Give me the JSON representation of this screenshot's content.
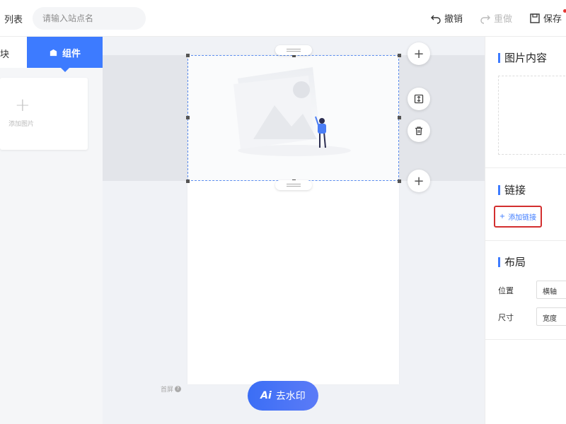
{
  "topbar": {
    "list_label": "列表",
    "search_placeholder": "请输入站点名",
    "undo_label": "撤销",
    "redo_label": "重做",
    "save_label": "保存"
  },
  "left_panel": {
    "tabs": [
      {
        "label": "块"
      },
      {
        "label": "组件"
      }
    ],
    "add_image_label": "添加图片"
  },
  "canvas": {
    "first_screen_label": "首屏",
    "watermark_button": {
      "ai_label": "Ai",
      "label": "去水印"
    }
  },
  "right_panel": {
    "image_section_title": "图片内容",
    "link_section_title": "链接",
    "add_link_label": "添加链接",
    "layout_section_title": "布局",
    "position_label": "位置",
    "position_value": "横轴",
    "size_label": "尺寸",
    "size_value": "宽度"
  },
  "colors": {
    "accent": "#3d7bff",
    "highlight_border": "#d32f2f"
  }
}
